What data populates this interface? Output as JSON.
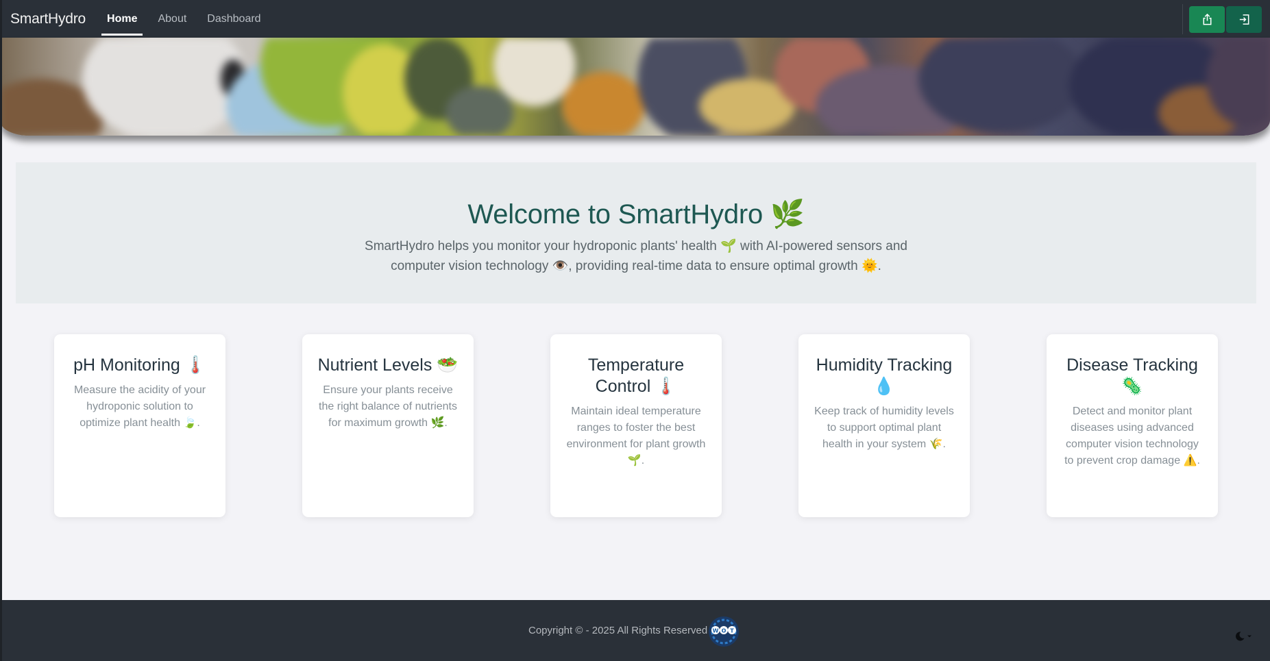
{
  "navbar": {
    "brand": "SmartHydro",
    "links": [
      {
        "label": "Home",
        "active": true
      },
      {
        "label": "About",
        "active": false
      },
      {
        "label": "Dashboard",
        "active": false
      }
    ],
    "buttons": [
      {
        "icon": "share-icon",
        "color": "#198754"
      },
      {
        "icon": "sign-in-icon",
        "color": "#13634b"
      }
    ]
  },
  "hero": {
    "image": "blurred-plants-banner-image"
  },
  "welcome": {
    "title": "Welcome to SmartHydro 🌿",
    "description": "SmartHydro helps you monitor your hydroponic plants' health 🌱 with AI-powered sensors and computer vision technology 👁️, providing real-time data to ensure optimal growth 🌞."
  },
  "features": [
    {
      "title": "pH Monitoring 🌡️",
      "description": "Measure the acidity of your hydroponic solution to optimize plant health 🍃."
    },
    {
      "title": "Nutrient Levels 🥗",
      "description": "Ensure your plants receive the right balance of nutrients for maximum growth 🌿."
    },
    {
      "title": "Temperature Control 🌡️",
      "description": "Maintain ideal temperature ranges to foster the best environment for plant growth 🌱."
    },
    {
      "title": "Humidity Tracking 💧",
      "description": "Keep track of humidity levels to support optimal plant health in your system 🌾."
    },
    {
      "title": "Disease Tracking 🦠",
      "description": "Detect and monitor plant diseases using advanced computer vision technology to prevent crop damage ⚠️."
    }
  ],
  "footer": {
    "copyright": "Copyright ©  - 2025 All Rights Reserved",
    "logo_text": "W O T",
    "theme_icon": "moon-icon"
  },
  "colors": {
    "navbar_bg": "#2a3038",
    "accent_green": "#198754",
    "title_teal": "#1e5852",
    "page_bg": "#f3f3f7"
  }
}
